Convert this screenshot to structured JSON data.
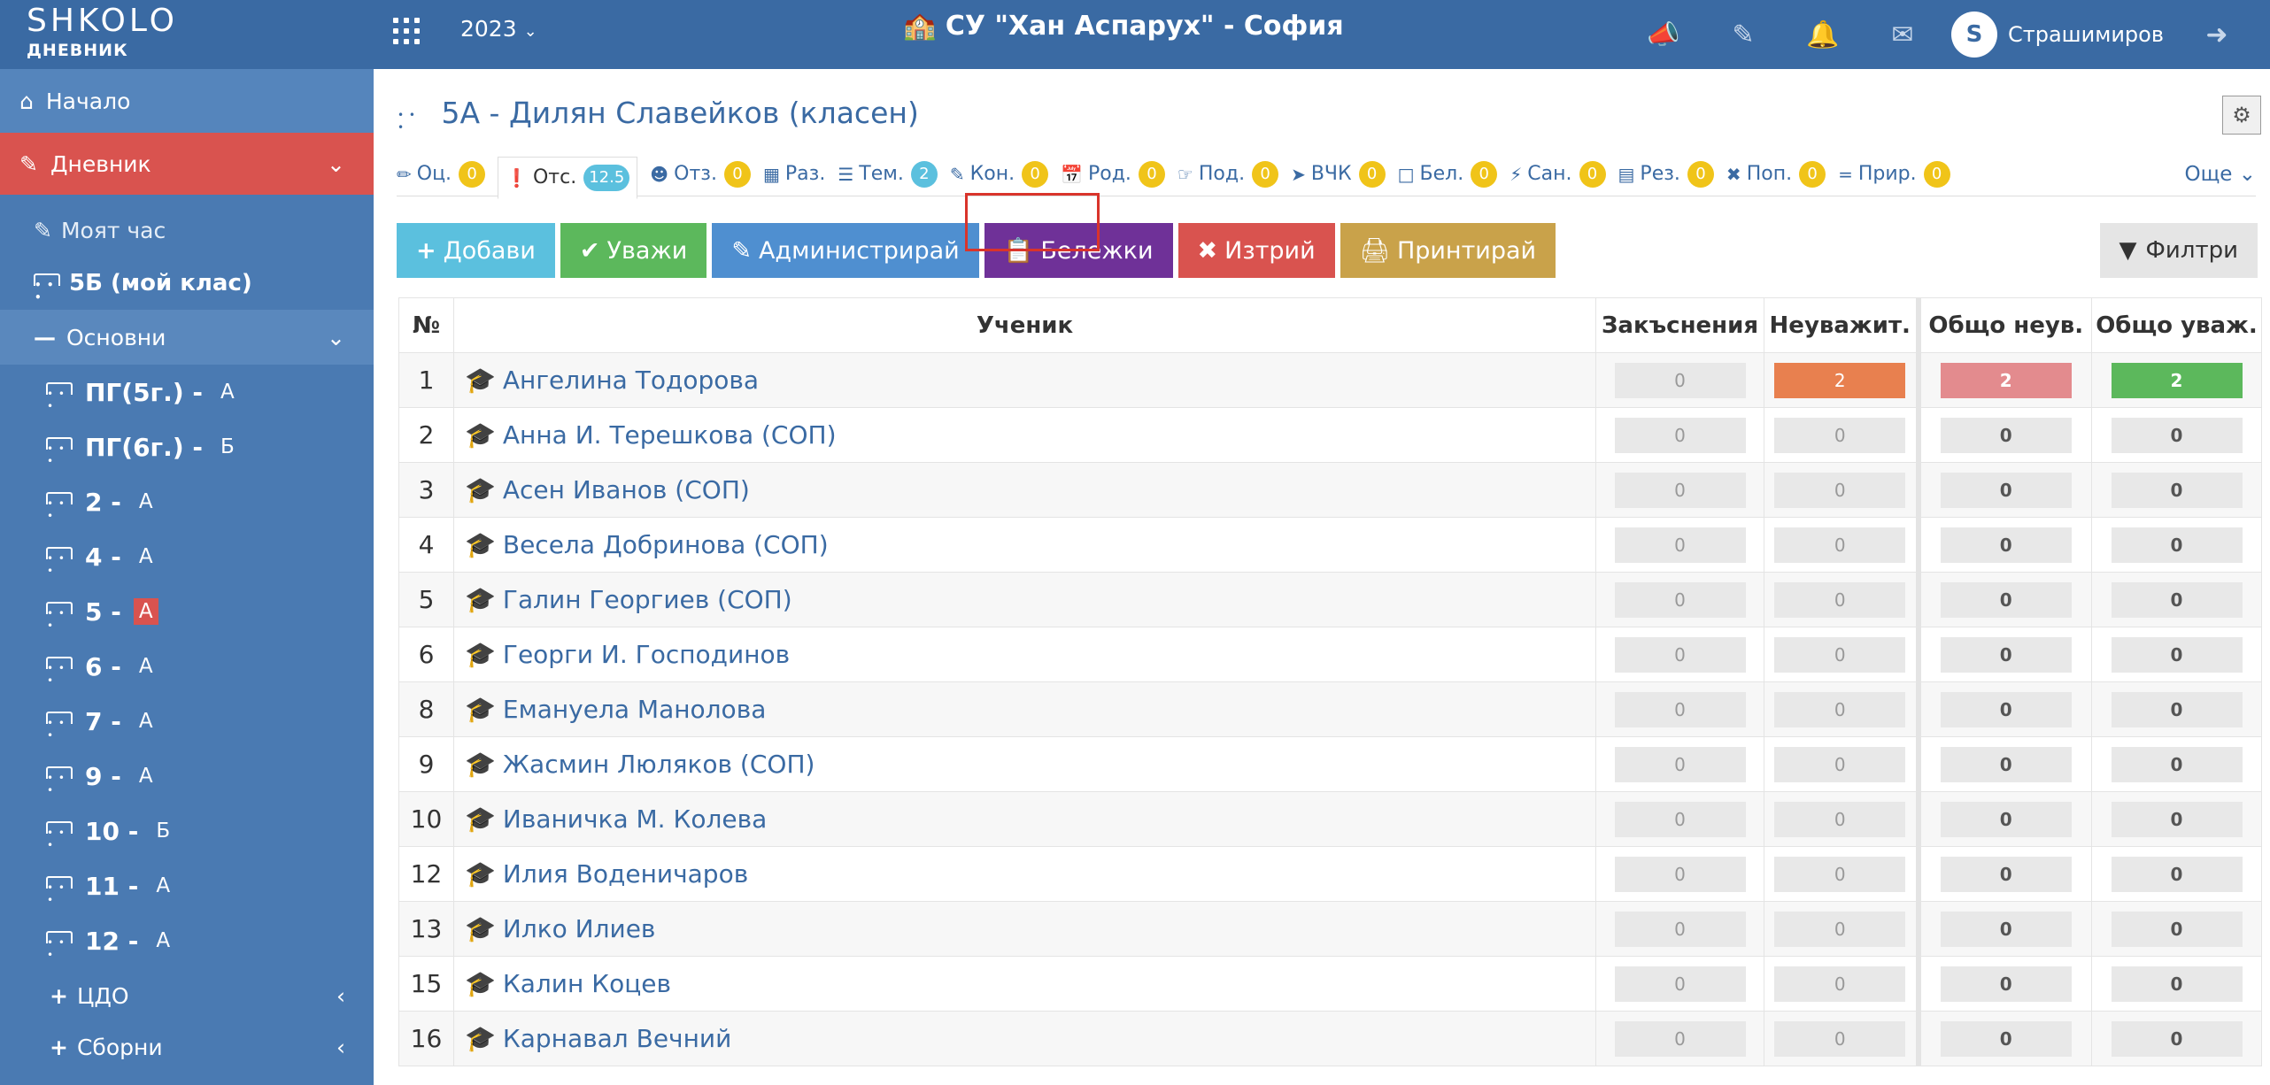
{
  "header": {
    "logo_main": "SHKOLO",
    "logo_sub": "ДНЕВНИК",
    "year": "2023",
    "school": "СУ \"Хан Аспарух\" - София",
    "user_initial": "S",
    "username": "Страшимиров"
  },
  "sidebar": {
    "home": "Начало",
    "diary": "Дневник",
    "my_hour": "Моят час",
    "my_class": "5Б (мой клас)",
    "basic": "Основни",
    "classes": [
      {
        "label": "ПГ(5г.) -",
        "parallel": "А"
      },
      {
        "label": "ПГ(6г.) -",
        "parallel": "Б"
      },
      {
        "label": "2 -",
        "parallel": "А"
      },
      {
        "label": "4 -",
        "parallel": "А"
      },
      {
        "label": "5 -",
        "parallel": "А"
      },
      {
        "label": "6 -",
        "parallel": "А"
      },
      {
        "label": "7 -",
        "parallel": "А"
      },
      {
        "label": "9 -",
        "parallel": "А"
      },
      {
        "label": "10 -",
        "parallel": "Б"
      },
      {
        "label": "11 -",
        "parallel": "А"
      },
      {
        "label": "12 -",
        "parallel": "А"
      }
    ],
    "cdo": "ЦДО",
    "mixed": "Сборни"
  },
  "page": {
    "title": "5А - Дилян Славейков (класен)"
  },
  "tabs": [
    {
      "label": "Оц.",
      "badge": "0"
    },
    {
      "label": "Отс.",
      "badge": "12.5"
    },
    {
      "label": "Отз.",
      "badge": "0"
    },
    {
      "label": "Раз.",
      "badge": ""
    },
    {
      "label": "Тем.",
      "badge": "2"
    },
    {
      "label": "Кон.",
      "badge": "0"
    },
    {
      "label": "Род.",
      "badge": "0"
    },
    {
      "label": "Под.",
      "badge": "0"
    },
    {
      "label": "ВЧК",
      "badge": "0"
    },
    {
      "label": "Бел.",
      "badge": "0"
    },
    {
      "label": "Сан.",
      "badge": "0"
    },
    {
      "label": "Рез.",
      "badge": "0"
    },
    {
      "label": "Поп.",
      "badge": "0"
    },
    {
      "label": "Прир.",
      "badge": "0"
    }
  ],
  "more": "Още",
  "toolbar": {
    "add": "Добави",
    "excuse": "Уважи",
    "admin": "Администрирай",
    "notes": "Бележки",
    "delete": "Изтрий",
    "print": "Принтирай",
    "filters": "Филтри"
  },
  "table": {
    "headers": [
      "№",
      "Ученик",
      "Закъснения",
      "Неуважит.",
      "Общо неув.",
      "Общо уваж."
    ],
    "rows": [
      {
        "num": "1",
        "name": "Ангелина Тодорова",
        "late": "0",
        "unexc": "2",
        "total_unexc": "2",
        "total_exc": "2"
      },
      {
        "num": "2",
        "name": "Анна И. Терешкова (СОП)",
        "late": "0",
        "unexc": "0",
        "total_unexc": "0",
        "total_exc": "0"
      },
      {
        "num": "3",
        "name": "Асен Иванов (СОП)",
        "late": "0",
        "unexc": "0",
        "total_unexc": "0",
        "total_exc": "0"
      },
      {
        "num": "4",
        "name": "Весела Добринова (СОП)",
        "late": "0",
        "unexc": "0",
        "total_unexc": "0",
        "total_exc": "0"
      },
      {
        "num": "5",
        "name": "Галин Георгиев (СОП)",
        "late": "0",
        "unexc": "0",
        "total_unexc": "0",
        "total_exc": "0"
      },
      {
        "num": "6",
        "name": "Георги И. Господинов",
        "late": "0",
        "unexc": "0",
        "total_unexc": "0",
        "total_exc": "0"
      },
      {
        "num": "8",
        "name": "Емануела Манолова",
        "late": "0",
        "unexc": "0",
        "total_unexc": "0",
        "total_exc": "0"
      },
      {
        "num": "9",
        "name": "Жасмин Люляков (СОП)",
        "late": "0",
        "unexc": "0",
        "total_unexc": "0",
        "total_exc": "0"
      },
      {
        "num": "10",
        "name": "Иваничка М. Колева",
        "late": "0",
        "unexc": "0",
        "total_unexc": "0",
        "total_exc": "0"
      },
      {
        "num": "12",
        "name": "Илия Воденичаров",
        "late": "0",
        "unexc": "0",
        "total_unexc": "0",
        "total_exc": "0"
      },
      {
        "num": "13",
        "name": "Илко Илиев",
        "late": "0",
        "unexc": "0",
        "total_unexc": "0",
        "total_exc": "0"
      },
      {
        "num": "15",
        "name": "Калин Коцев",
        "late": "0",
        "unexc": "0",
        "total_unexc": "0",
        "total_exc": "0"
      },
      {
        "num": "16",
        "name": "Карнавал Вечний",
        "late": "0",
        "unexc": "0",
        "total_unexc": "0",
        "total_exc": "0"
      }
    ]
  },
  "colors": {
    "topbar": "#3a6aa3",
    "sidebar": "#4a7ab2",
    "active_red": "#d9534f",
    "notes_purple": "#6f3198",
    "highlight": "#d9342b"
  }
}
